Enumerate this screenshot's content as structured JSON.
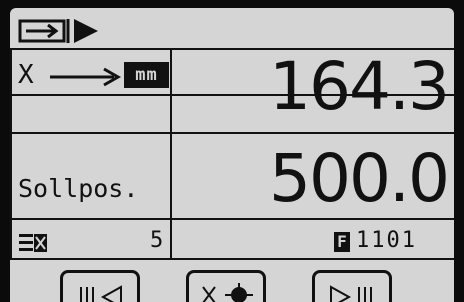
{
  "status": {
    "icon": "insert-card-icon"
  },
  "axis": {
    "letter": "X",
    "direction_icon": "right-arrow-icon",
    "unit": "mm"
  },
  "actual_position": "164.3",
  "target": {
    "label": "Sollpos.",
    "value": "500.0"
  },
  "info": {
    "tool_icon": "tool-table-icon",
    "count": "5",
    "program_prefix": "F",
    "program_number": "1101"
  },
  "softkeys": [
    {
      "icon": "pause-left-triangle-icon"
    },
    {
      "icon": "x-axis-jog-icon"
    },
    {
      "icon": "right-triangle-pause-icon"
    }
  ]
}
